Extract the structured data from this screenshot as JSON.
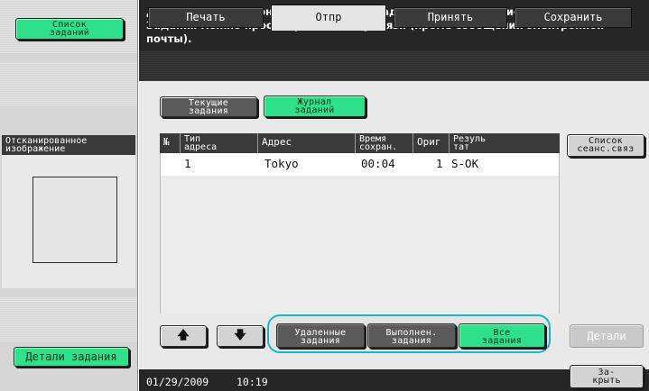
{
  "left_panel": {
    "job_list_button": [
      "Список",
      "заданий"
    ],
    "thumbnail_label": [
      "Отсканированное",
      "изображение"
    ],
    "job_details_button": "Детали задания"
  },
  "header": {
    "message_line1": "Для просмотра журнала переданных заданий нажмите [Список сеансов связи].",
    "message_line2": "Задания можно просмотреть по типу связи (кроме сообщений электронной почты)."
  },
  "tabs": [
    {
      "label": "Печать",
      "active": false
    },
    {
      "label": "Отпр",
      "active": true
    },
    {
      "label": "Принять",
      "active": false
    },
    {
      "label": "Сохранить",
      "active": false
    }
  ],
  "view_toggle": {
    "current_jobs": [
      "Текущие",
      "задания"
    ],
    "job_log": [
      "Журнал",
      "заданий"
    ]
  },
  "table": {
    "headers": {
      "num": "№",
      "addr_type": [
        "Тип",
        "адреса"
      ],
      "address": "Адрес",
      "time_saved": [
        "Время",
        "сохран."
      ],
      "originals": "Ориг",
      "result": [
        "Резуль",
        "тат"
      ]
    },
    "rows": [
      {
        "num": "1",
        "addr_type": "",
        "address": "Tokyo",
        "time": "00:04",
        "originals": "1",
        "result": "S-OK"
      }
    ]
  },
  "comm_list_button": [
    "Список",
    "сеанс.связ"
  ],
  "filters": {
    "deleted": [
      "Удаленные",
      "задания"
    ],
    "completed": [
      "Выполнен.",
      "задания"
    ],
    "all": [
      "Все",
      "задания"
    ],
    "selected": "all"
  },
  "details_button": "Детали",
  "close_button": [
    "За-",
    "крыть"
  ],
  "footer": {
    "date": "01/29/2009",
    "time": "10:19"
  },
  "colors": {
    "accent_green": "#2fe08a",
    "highlight_cyan": "#17b6c9",
    "dark_bar": "#262626"
  },
  "icons": {
    "scroll_up": "arrow-up-icon",
    "scroll_down": "arrow-down-icon"
  }
}
